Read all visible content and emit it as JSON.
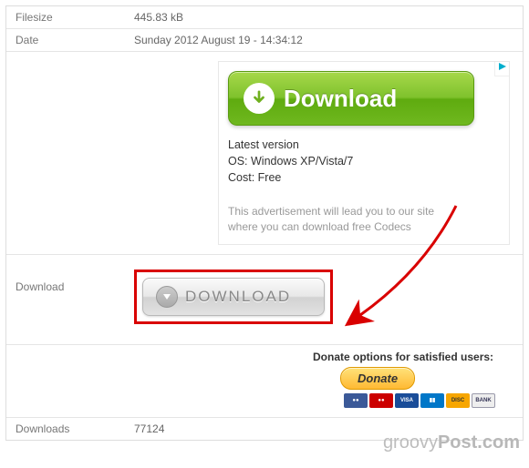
{
  "rows": {
    "filesize": {
      "label": "Filesize",
      "value": "445.83 kB"
    },
    "date": {
      "label": "Date",
      "value": "Sunday 2012 August 19 - 14:34:12"
    },
    "download": {
      "label": "Download"
    },
    "downloads": {
      "label": "Downloads",
      "value": "77124"
    }
  },
  "ad": {
    "button_text": "Download",
    "latest": "Latest version",
    "os": "OS: Windows XP/Vista/7",
    "cost": "Cost: Free",
    "footer_line1": "This advertisement will lead you to our site",
    "footer_line2": "where you can download free Codecs"
  },
  "download_button": {
    "text": "DOWNLOAD"
  },
  "donate": {
    "label": "Donate options for satisfied users:",
    "button": "Donate"
  },
  "watermark": {
    "prefix": "groovy",
    "suffix": "Post.com"
  }
}
